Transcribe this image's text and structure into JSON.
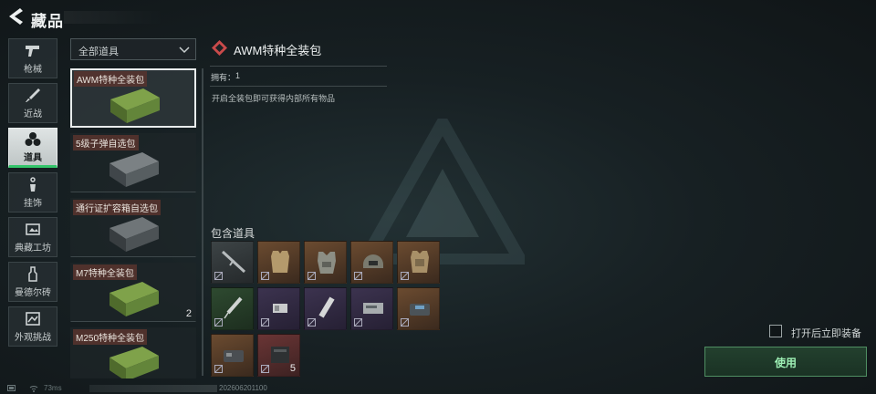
{
  "header": {
    "title": "藏品"
  },
  "categories": [
    {
      "label": "枪械",
      "icon": "gun-icon"
    },
    {
      "label": "近战",
      "icon": "knife-icon"
    },
    {
      "label": "道具",
      "icon": "grenade-icon",
      "active": true
    },
    {
      "label": "挂饰",
      "icon": "charm-icon"
    },
    {
      "label": "典藏工坊",
      "icon": "workshop-icon"
    },
    {
      "label": "曼德尔砖",
      "icon": "brick-icon"
    },
    {
      "label": "外观挑战",
      "icon": "challenge-icon"
    }
  ],
  "filter": {
    "selected": "全部道具"
  },
  "items": [
    {
      "name": "AWM特种全装包",
      "count": "",
      "selected": true,
      "color": "green"
    },
    {
      "name": "5级子弹自选包",
      "count": "",
      "color": "dark"
    },
    {
      "name": "通行证扩容箱自选包",
      "count": "",
      "color": "dark"
    },
    {
      "name": "M7特种全装包",
      "count": "2",
      "color": "green"
    },
    {
      "name": "M250特种全装包",
      "count": "",
      "color": "green"
    }
  ],
  "detail": {
    "name": "AWM特种全装包",
    "owned_label": "拥有：",
    "owned_value": "1",
    "description": "开启全装包即可获得内部所有物品"
  },
  "contents": {
    "title": "包含道具",
    "slots": [
      {
        "quality": "white",
        "icon": "rifle-icon",
        "count": ""
      },
      {
        "quality": "gold",
        "icon": "vest-icon",
        "count": ""
      },
      {
        "quality": "gold",
        "icon": "rig-icon",
        "count": ""
      },
      {
        "quality": "gold",
        "icon": "helmet-icon",
        "count": ""
      },
      {
        "quality": "gold",
        "icon": "armor-icon",
        "count": ""
      },
      {
        "quality": "green",
        "icon": "syringe-icon",
        "count": ""
      },
      {
        "quality": "purple",
        "icon": "ammo-icon",
        "count": ""
      },
      {
        "quality": "purple",
        "icon": "stim-icon",
        "count": ""
      },
      {
        "quality": "purple",
        "icon": "medkit-icon",
        "count": ""
      },
      {
        "quality": "gold",
        "icon": "bag-icon",
        "count": ""
      },
      {
        "quality": "gold",
        "icon": "pack-icon",
        "count": ""
      },
      {
        "quality": "red",
        "icon": "case-icon",
        "count": "5"
      }
    ]
  },
  "actions": {
    "auto_equip_label": "打开后立即装备",
    "use_label": "使用"
  },
  "status": {
    "ping": "73ms",
    "uid": "202606201100"
  },
  "colors": {
    "accent": "#33c46a",
    "use_text": "#9ef0b5"
  }
}
